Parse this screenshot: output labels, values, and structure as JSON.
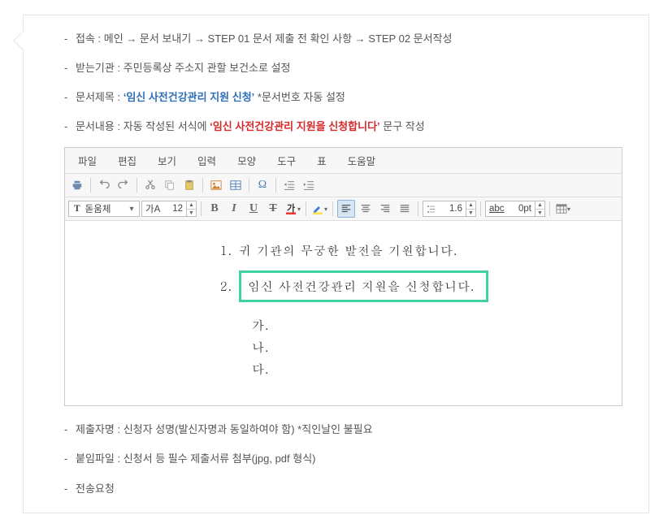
{
  "intro": {
    "access_label": "접속 :",
    "access_path": "메인 → 문서 보내기 → STEP 01 문서 제출 전 확인 사항 → STEP 02 문서작성",
    "recv_label": "받는기관 :",
    "recv_value": "주민등록상 주소지 관할 보건소로 설정",
    "title_label": "문서제목 :",
    "title_value_quoted": "‘임신 사전건강관리 지원 신청’",
    "title_note": " *문서번호 자동 설정",
    "content_label": "문서내용 :",
    "content_prefix": "자동 작성된 서식에 ",
    "content_quoted": "‘임신 사전건강관리 지원을 신청합니다’",
    "content_suffix": " 문구 작성"
  },
  "menubar": [
    "파일",
    "편집",
    "보기",
    "입력",
    "모양",
    "도구",
    "표",
    "도움말"
  ],
  "font_combo": {
    "label": "돋움체"
  },
  "size_combo": {
    "prefix": "가A",
    "value": "12"
  },
  "line_combo": {
    "value": "1.6"
  },
  "width_combo": {
    "value": "0pt",
    "prefix": "abc"
  },
  "doc": {
    "line1_num": "1.",
    "line1_text": "귀 기관의 무궁한 발전을 기원합니다.",
    "line2_num": "2.",
    "line2_text": "임신 사전건강관리 지원을 신청합니다.",
    "sub": [
      "가.",
      "나.",
      "다."
    ]
  },
  "outro": {
    "submitter_label": "제출자명 :",
    "submitter_value": "신청자 성명(발신자명과 동일하여야 함) *직인날인 불필요",
    "attach_label": "붙임파일 :",
    "attach_value": "신청서 등 필수 제출서류 첨부(jpg, pdf 형식)",
    "send_label": "전송요청"
  }
}
